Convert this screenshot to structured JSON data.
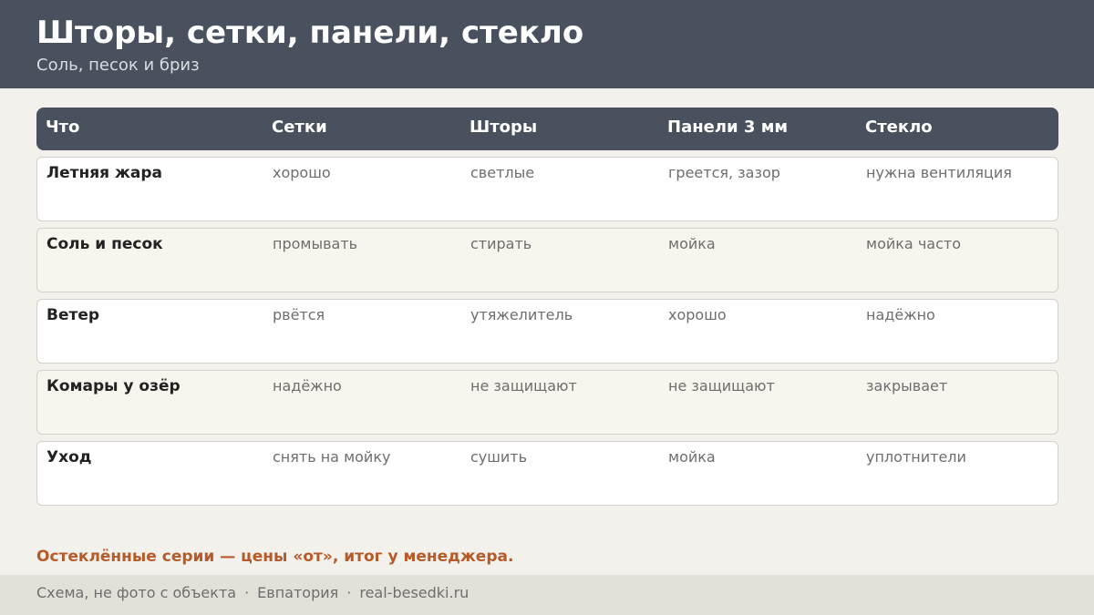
{
  "header": {
    "title": "Шторы, сетки, панели, стекло",
    "subtitle": "Соль, песок и бриз"
  },
  "table": {
    "columns": [
      "Что",
      "Сетки",
      "Шторы",
      "Панели 3 мм",
      "Стекло"
    ],
    "rows": [
      [
        "Летняя жара",
        "хорошо",
        "светлые",
        "греется, зазор",
        "нужна вентиляция"
      ],
      [
        "Соль и песок",
        "промывать",
        "стирать",
        "мойка",
        "мойка часто"
      ],
      [
        "Ветер",
        "рвётся",
        "утяжелитель",
        "хорошо",
        "надёжно"
      ],
      [
        "Комары у озёр",
        "надёжно",
        "не защищают",
        "не защищают",
        "закрывает"
      ],
      [
        "Уход",
        "снять на мойку",
        "сушить",
        "мойка",
        "уплотнители"
      ]
    ]
  },
  "footnote": "Остеклённые серии — цены «от», итог у менеджера.",
  "footer": {
    "note": "Схема, не фото с объекта",
    "city": "Евпатория",
    "site": "real-besedki.ru",
    "separator": "·"
  },
  "colors": {
    "header_bg": "#48515d",
    "page_bg": "#f3f1ec",
    "accent": "#b65a2a",
    "footer_bg": "#e3e0d9"
  }
}
